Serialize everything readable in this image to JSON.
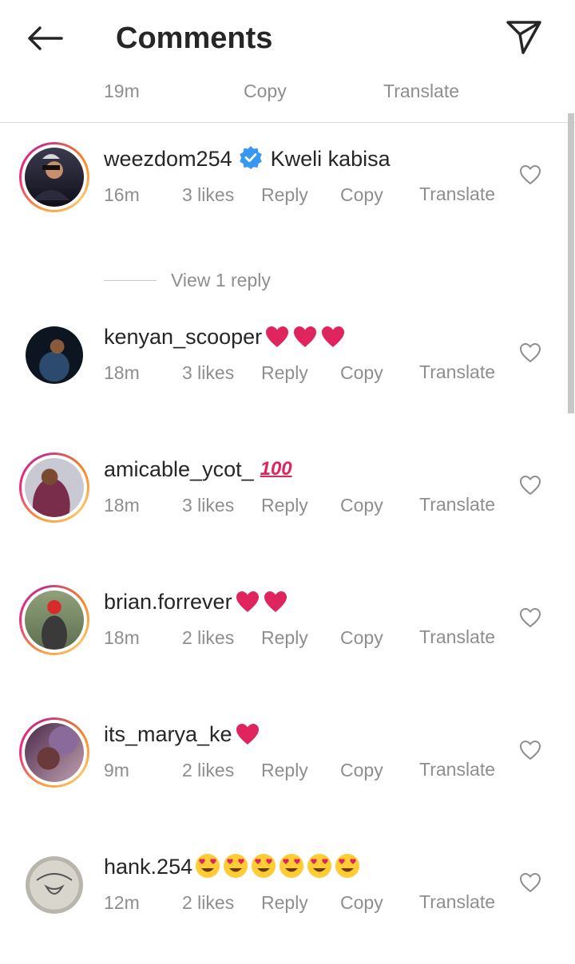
{
  "header": {
    "title": "Comments"
  },
  "previous_actions": {
    "time": "19m",
    "copy": "Copy",
    "translate": "Translate"
  },
  "view_replies": "View 1 reply",
  "comments": [
    {
      "username": "weezdom254",
      "verified": true,
      "text": "Kweli kabisa",
      "time": "16m",
      "likes": "3 likes",
      "reply": "Reply",
      "copy": "Copy",
      "translate": "Translate",
      "emoji": "none",
      "ring": true
    },
    {
      "username": "kenyan_scooper",
      "verified": false,
      "text": "",
      "time": "18m",
      "likes": "3 likes",
      "reply": "Reply",
      "copy": "Copy",
      "translate": "Translate",
      "emoji": "3x red-heart",
      "ring": false
    },
    {
      "username": "amicable_ycot_",
      "verified": false,
      "text": "",
      "time": "18m",
      "likes": "3 likes",
      "reply": "Reply",
      "copy": "Copy",
      "translate": "Translate",
      "emoji": "hundred-points",
      "ring": true
    },
    {
      "username": "brian.forrever",
      "verified": false,
      "text": "",
      "time": "18m",
      "likes": "2 likes",
      "reply": "Reply",
      "copy": "Copy",
      "translate": "Translate",
      "emoji": "2x red-heart",
      "ring": true
    },
    {
      "username": "its_marya_ke",
      "verified": false,
      "text": "",
      "time": "9m",
      "likes": "2 likes",
      "reply": "Reply",
      "copy": "Copy",
      "translate": "Translate",
      "emoji": "1x red-heart",
      "ring": true
    },
    {
      "username": "hank.254",
      "verified": false,
      "text": "",
      "time": "12m",
      "likes": "2 likes",
      "reply": "Reply",
      "copy": "Copy",
      "translate": "Translate",
      "emoji": "6x heart-eyes-face",
      "ring": false
    }
  ],
  "colors": {
    "text": "#262626",
    "secondary": "#8e8e8e",
    "verified": "#3897f0",
    "heart": "#e0245e"
  }
}
